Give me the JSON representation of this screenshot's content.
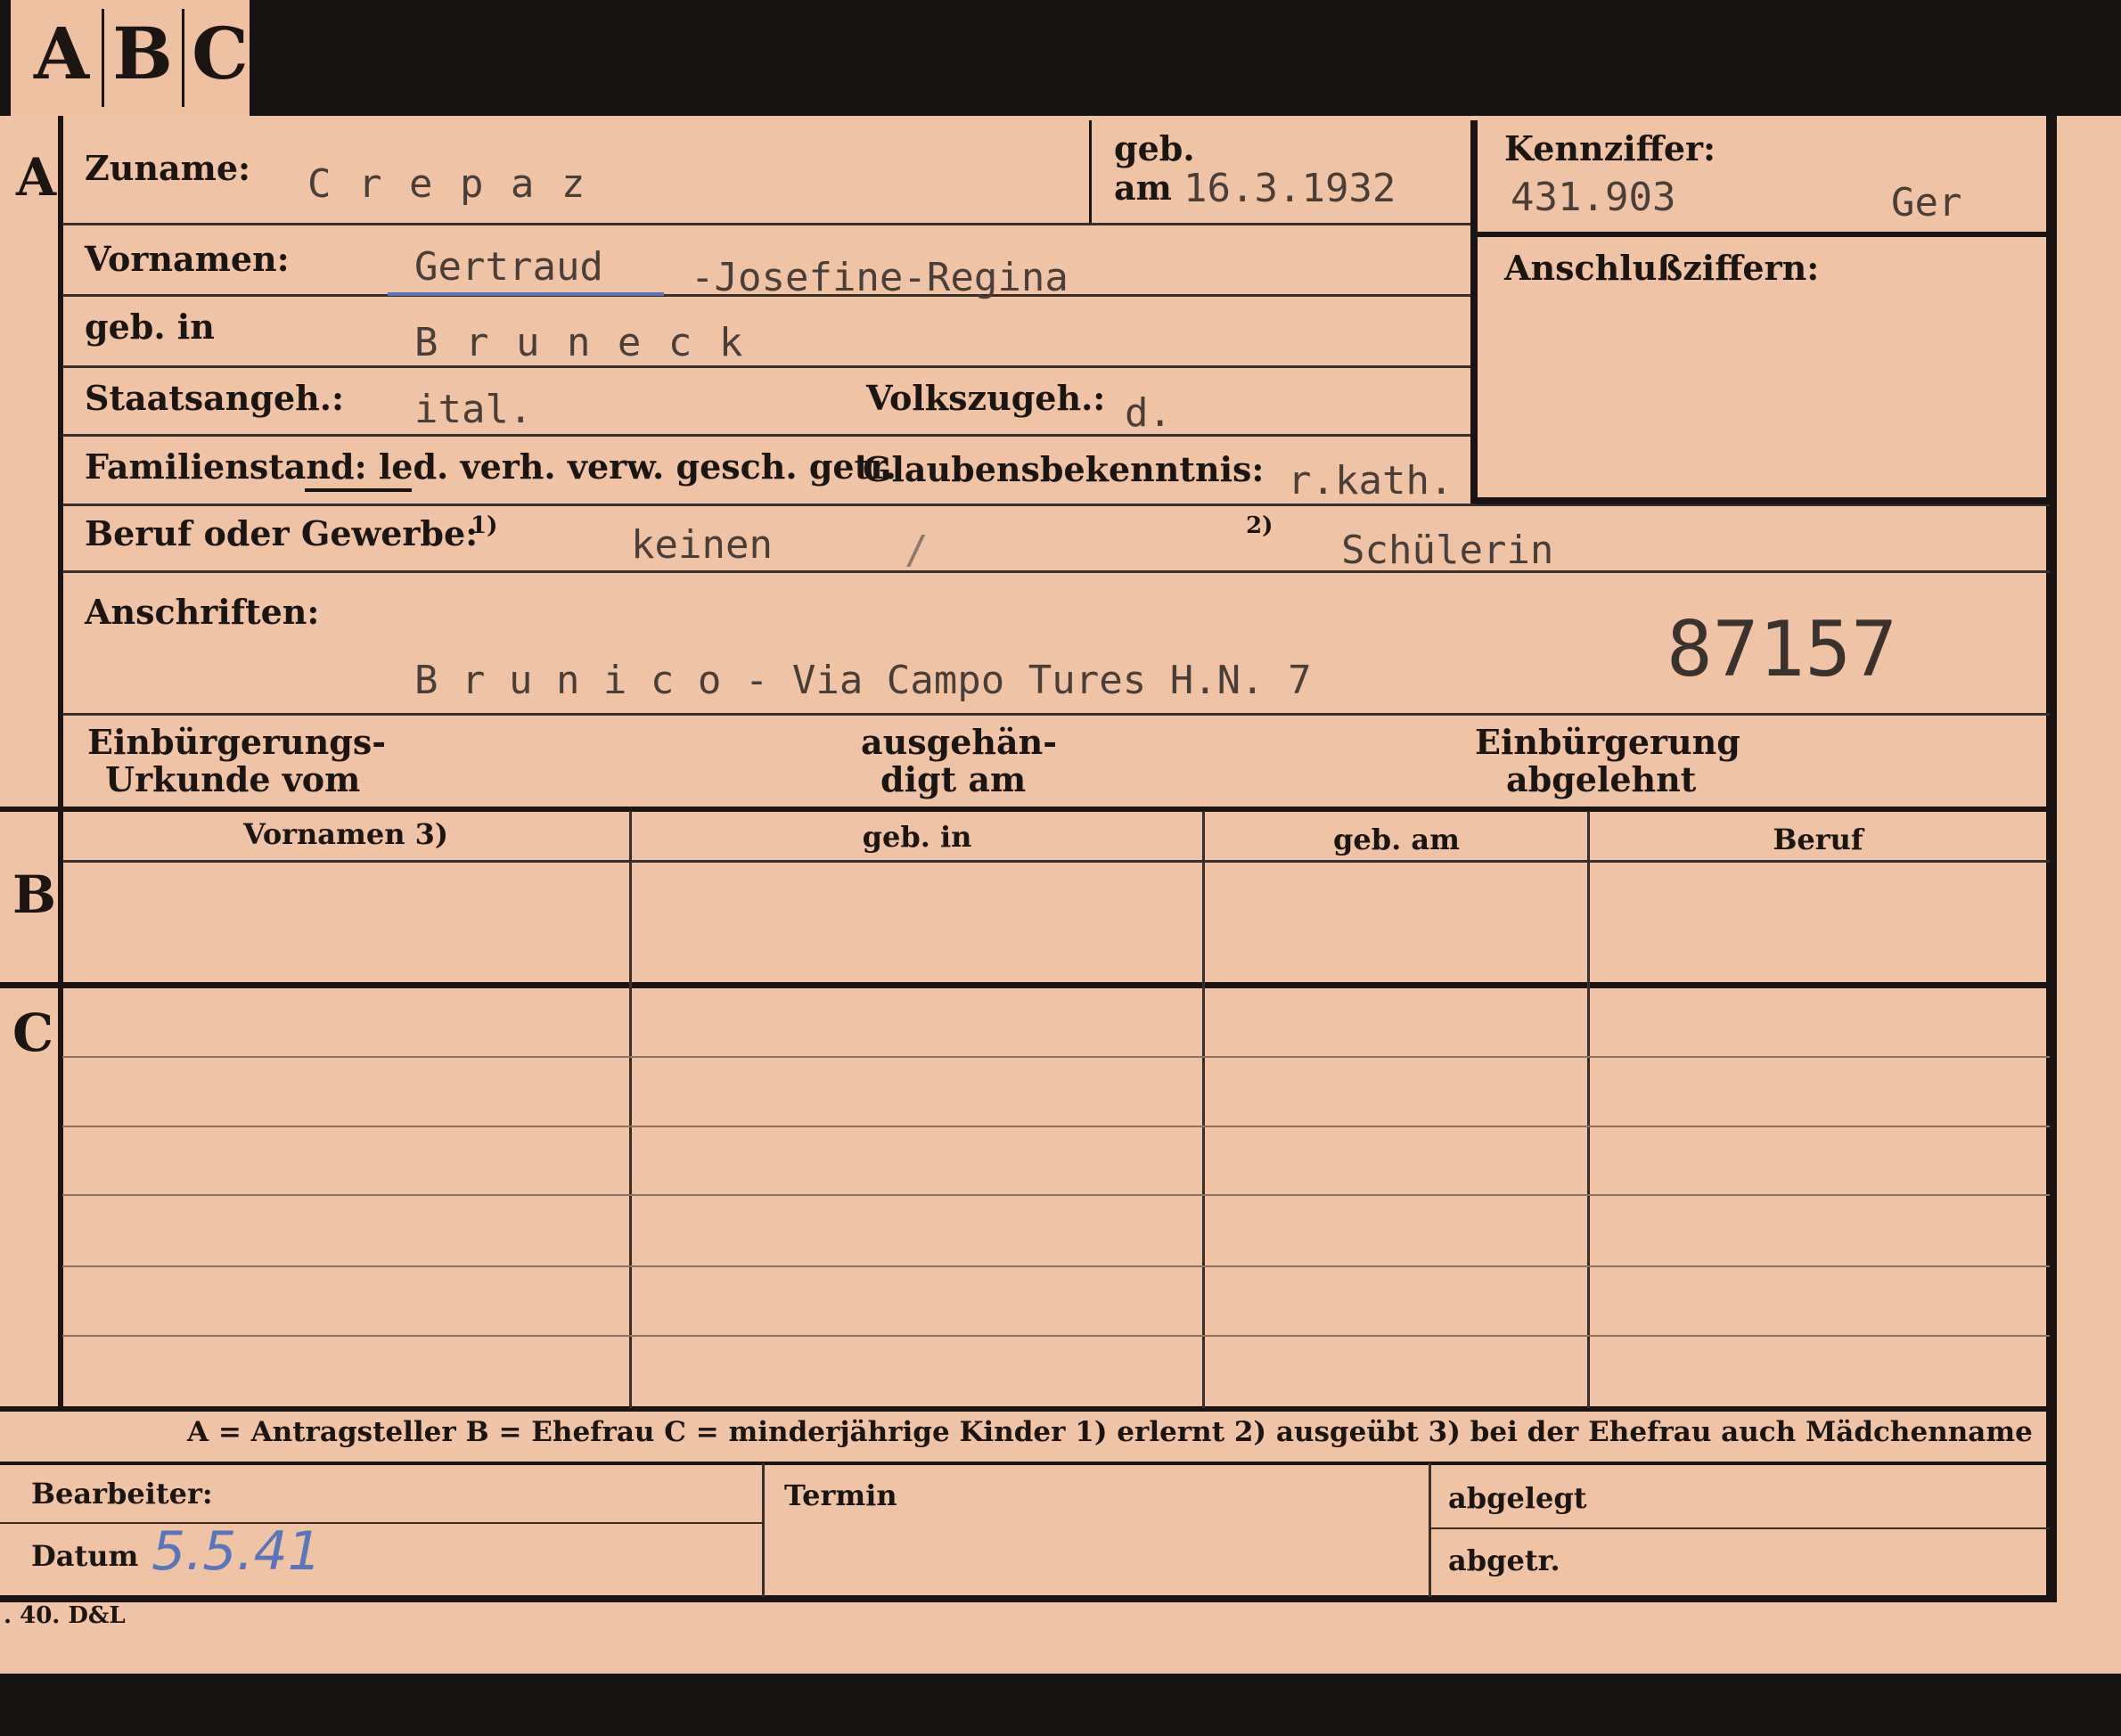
{
  "tabs": [
    "A",
    "B",
    "C"
  ],
  "sections": {
    "a": "A",
    "b": "B",
    "c": "C"
  },
  "labels": {
    "zuname": "Zuname:",
    "geb_line1": "geb.",
    "geb_line2": "am",
    "kennziffer": "Kennziffer:",
    "vornamen": "Vornamen:",
    "geb_in": "geb. in",
    "anschluss": "Anschlußziffern:",
    "staatsangeh": "Staatsangeh.:",
    "volkszugeh": "Volkszugeh.:",
    "familienstand": "Familienstand: led. verh. verw. gesch. getr.",
    "glaube": "Glaubensbekenntnis:",
    "beruf": "Beruf oder Gewerbe:",
    "fn1": "1)",
    "fn2": "2)",
    "anschriften": "Anschriften:",
    "einb_urkunde_1": "Einbürgerungs-",
    "einb_urkunde_2": "Urkunde vom",
    "ausgehaendigt_1": "ausgehän-",
    "ausgehaendigt_2": "digt am",
    "einb_abgelehnt_1": "Einbürgerung",
    "einb_abgelehnt_2": "abgelehnt"
  },
  "values": {
    "zuname": "C r e p a z",
    "geb_am": "16.3.1932",
    "kennziffer": "431.903",
    "kennziffer_suffix": "Ger",
    "vornamen_first": "Gertraud",
    "vornamen_rest": "-Josefine-Regina",
    "geb_in": "B r u n e c k",
    "staatsangeh": "ital.",
    "volkszugeh": "d.",
    "glaube": "r.kath.",
    "beruf1": "keinen",
    "beruf_slash": "/",
    "beruf2": "Schülerin",
    "anschrift": "B r u n i c o - Via Campo Tures H.N. 7",
    "stamp_number": "87157"
  },
  "table": {
    "headers": [
      "Vornamen 3)",
      "geb. in",
      "geb. am",
      "Beruf"
    ]
  },
  "legend": "A = Antragsteller   B = Ehefrau   C = minderjährige Kinder   1) erlernt   2) ausgeübt   3) bei der Ehefrau auch Mädchenname",
  "footer": {
    "bearbeiter": "Bearbeiter:",
    "datum": "Datum",
    "datum_value": "5.5.41",
    "termin": "Termin",
    "abgelegt": "abgelegt",
    "abgetr": "abgetr."
  },
  "printer_mark": ". 40. D&L",
  "colors": {
    "card": "#efc3a5",
    "ink": "#1c1612",
    "type": "#4a3f38",
    "handwriting": "#5a75b8"
  }
}
